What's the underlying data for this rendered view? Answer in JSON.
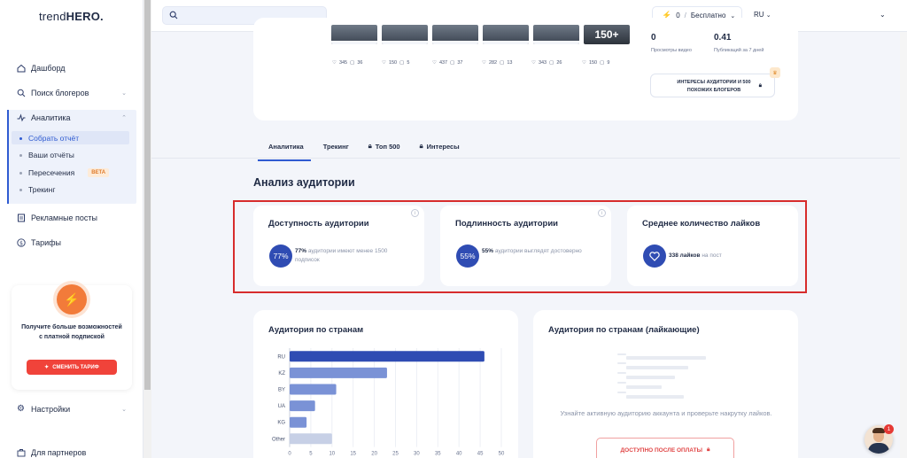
{
  "app": {
    "logo_main": "trend",
    "logo_bold": "HERO",
    "logo_dot": "."
  },
  "sidebar": {
    "dashboard": "Дашборд",
    "search_bloggers": "Поиск блогеров",
    "analytics": "Аналитика",
    "analytics_sub": [
      {
        "label": "Собрать отчёт",
        "active": true
      },
      {
        "label": "Ваши отчёты",
        "active": false
      },
      {
        "label": "Пересечения",
        "active": false,
        "badge": "BETA"
      },
      {
        "label": "Трекинг",
        "active": false
      }
    ],
    "ad_posts": "Рекламные посты",
    "tariffs": "Тарифы",
    "settings": "Настройки",
    "partners": "Для партнеров",
    "promo": {
      "text": "Получите больше возможностей с платной подпиской",
      "button": "СМЕНИТЬ ТАРИФ"
    }
  },
  "topbar": {
    "credits": "0",
    "plan": "Бесплатно",
    "lang": "RU"
  },
  "profile": {
    "thumbs": [
      {
        "likes": "345",
        "comments": "36"
      },
      {
        "likes": "150",
        "comments": "5"
      },
      {
        "likes": "437",
        "comments": "37"
      },
      {
        "likes": "282",
        "comments": "13"
      },
      {
        "likes": "343",
        "comments": "26"
      },
      {
        "likes": "150",
        "comments": "9",
        "overlay": "150+"
      }
    ],
    "video_views": "0",
    "video_views_label": "Просмотры видео",
    "posts_per_week": "0.41",
    "posts_per_week_label": "Публикаций за 7 дней",
    "interests_button": "ИНТЕРЕСЫ АУДИТОРИИ И 500 ПОХОЖИХ БЛОГЕРОВ"
  },
  "tabs": [
    {
      "label": "Аналитика",
      "locked": false,
      "active": true
    },
    {
      "label": "Трекинг",
      "locked": false,
      "active": false
    },
    {
      "label": "Топ 500",
      "locked": true,
      "active": false
    },
    {
      "label": "Интересы",
      "locked": true,
      "active": false
    }
  ],
  "audience": {
    "title": "Анализ аудитории",
    "cards": [
      {
        "title": "Доступность аудитории",
        "value": "77%",
        "bold": "77%",
        "text": " аудитории имеют менее 1500 подписок"
      },
      {
        "title": "Подлинность аудитории",
        "value": "55%",
        "bold": "55%",
        "text": " аудитории выглядят достоверно"
      },
      {
        "title": "Среднее количество лайков",
        "value": "heart-icon",
        "bold": "338 лайков",
        "text": " на пост"
      }
    ]
  },
  "countries": {
    "title": "Аудитория по странам",
    "liking_title": "Аудитория по странам (лайкающие)",
    "liking_note": "Узнайте активную аудиторию аккаунта и проверьте накрутку лайков.",
    "liking_cta": "ДОСТУПНО ПОСЛЕ ОПЛАТЫ"
  },
  "chart_data": {
    "type": "bar",
    "orientation": "horizontal",
    "categories": [
      "RU",
      "KZ",
      "BY",
      "UA",
      "KG",
      "Other"
    ],
    "values": [
      46,
      23,
      11,
      6,
      4,
      10
    ],
    "xlim": [
      0,
      50
    ],
    "xticks": [
      0,
      5,
      10,
      15,
      20,
      25,
      30,
      35,
      40,
      45,
      50
    ],
    "colors": [
      "#2f4cb3",
      "#7a92d6",
      "#7a92d6",
      "#7a92d6",
      "#7a92d6",
      "#c7d0e6"
    ],
    "grid": true
  },
  "notifications": {
    "count": "1"
  }
}
